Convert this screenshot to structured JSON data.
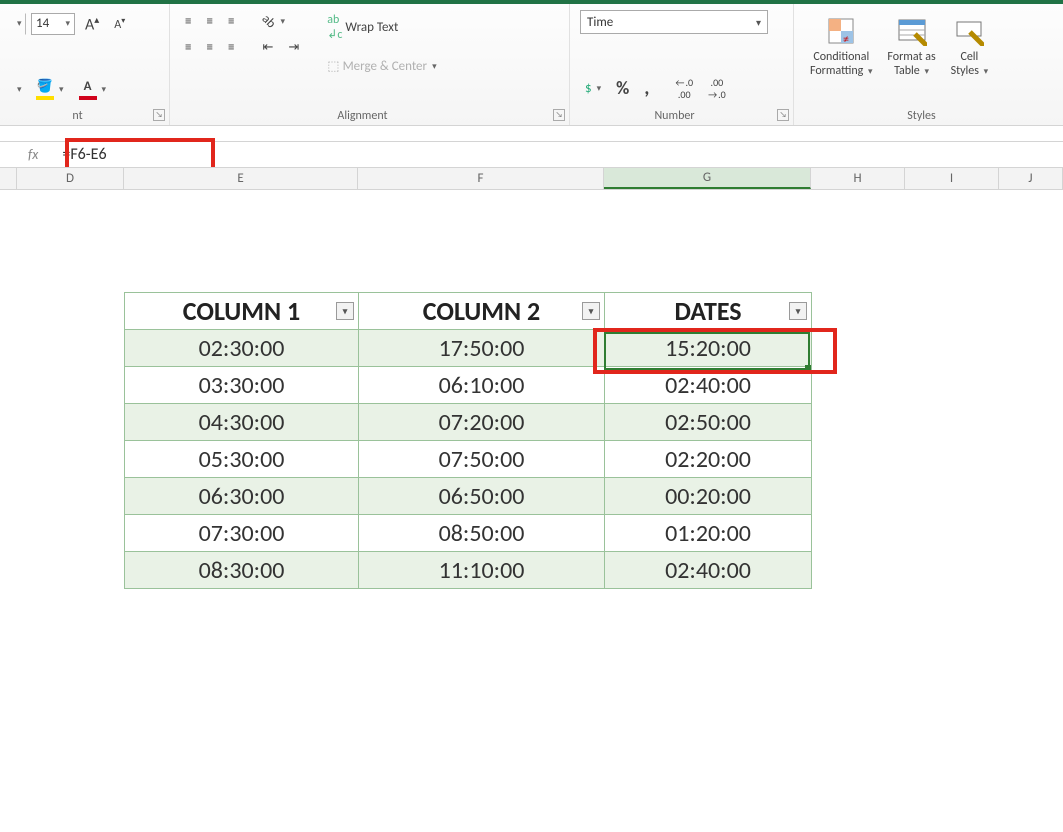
{
  "ribbon": {
    "font": {
      "size_value": "14",
      "group_label": "nt"
    },
    "alignment": {
      "wrap_label": "Wrap Text",
      "merge_label": "Merge & Center",
      "group_label": "Alignment"
    },
    "number": {
      "format_selected": "Time",
      "percent": "%",
      "comma": ",",
      "group_label": "Number"
    },
    "styles": {
      "conditional_line1": "Conditional",
      "conditional_line2": "Formatting",
      "formatas_line1": "Format as",
      "formatas_line2": "Table",
      "cell_line1": "Cell",
      "cell_line2": "Styles",
      "group_label": "Styles"
    }
  },
  "formula_bar": {
    "fx_symbol": "fx",
    "formula": "=F6-E6"
  },
  "columns": {
    "blank0": "",
    "D": "D",
    "E": "E",
    "F": "F",
    "G": "G",
    "H": "H",
    "I": "I",
    "J": "J"
  },
  "table": {
    "headers": {
      "c1": "COLUMN 1",
      "c2": "COLUMN 2",
      "c3": "DATES"
    },
    "rows": [
      {
        "c1": "02:30:00",
        "c2": "17:50:00",
        "c3": "15:20:00"
      },
      {
        "c1": "03:30:00",
        "c2": "06:10:00",
        "c3": "02:40:00"
      },
      {
        "c1": "04:30:00",
        "c2": "07:20:00",
        "c3": "02:50:00"
      },
      {
        "c1": "05:30:00",
        "c2": "07:50:00",
        "c3": "02:20:00"
      },
      {
        "c1": "06:30:00",
        "c2": "06:50:00",
        "c3": "00:20:00"
      },
      {
        "c1": "07:30:00",
        "c2": "08:50:00",
        "c3": "01:20:00"
      },
      {
        "c1": "08:30:00",
        "c2": "11:10:00",
        "c3": "02:40:00"
      }
    ]
  },
  "increase_dec": ".0",
  "increase_dec_small": ".00",
  "decrease_dec": ".00",
  "decrease_dec_small": ".0"
}
